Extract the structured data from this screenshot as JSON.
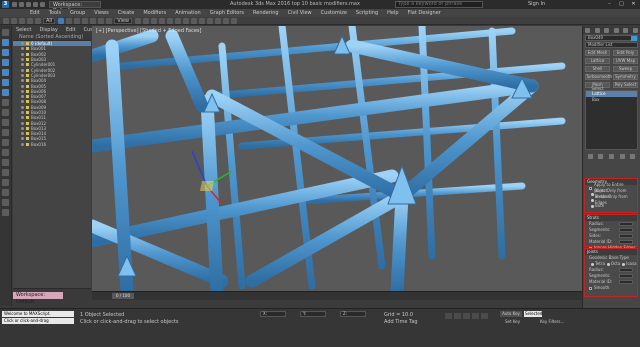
{
  "app": {
    "title": "Autodesk 3ds Max 2016   top 10 basic modifiers.max",
    "workspace": "Workspace: Default",
    "search_placeholder": "Type a keyword or phrase",
    "sign_in": "Sign In"
  },
  "menu": [
    "Edit",
    "Tools",
    "Group",
    "Views",
    "Create",
    "Modifiers",
    "Animation",
    "Graph Editors",
    "Rendering",
    "Civil View",
    "Customize",
    "Scripting",
    "Help",
    "Flat Designer"
  ],
  "toolbar": {
    "selection_filter": "All",
    "view_dropdown": "View"
  },
  "explorer": {
    "tabs": [
      "Select",
      "Display",
      "Edit",
      "Customize"
    ],
    "header": "Name (Sorted Ascending)",
    "items": [
      "0 (default)",
      "Box001",
      "Box002",
      "Box003",
      "Cylinder001",
      "Cylinder002",
      "Cylinder003",
      "Box004",
      "Box005",
      "Box006",
      "Box007",
      "Box008",
      "Box009",
      "Box010",
      "Box011",
      "Box012",
      "Box013",
      "Box014",
      "Box015",
      "Box016"
    ],
    "selected_index": 0
  },
  "viewport": {
    "label": "[+] [Perspective] [Shaded + Edged Faces]"
  },
  "timeline": {
    "frame": "0 / 100"
  },
  "status": {
    "workspace_tag": "Workspace: Default",
    "maxscript_1": "Welcome to MAXScript.",
    "maxscript_2": "Click or click-and-drag",
    "msg1": "1 Object Selected",
    "msg2": "Click or click-and-drag to select objects",
    "x": "X:",
    "y": "Y:",
    "z": "Z:",
    "grid": "Grid = 10.0",
    "add_time_tag": "Add Time Tag",
    "auto_key": "Auto Key",
    "selected": "Selected",
    "set_key": "Set Key",
    "key_filters": "Key Filters..."
  },
  "command_panel": {
    "object_name": "Box040",
    "modifier_list": "Modifier List",
    "buttons": [
      [
        "Edit Mesh",
        "Edit Poly"
      ],
      [
        "Lattice",
        "UVW Map"
      ],
      [
        "Shell",
        "Sweep"
      ],
      [
        "Turbosmooth",
        "Symmetry"
      ],
      [
        "Mesh Select",
        "Poly Select"
      ]
    ],
    "stack": [
      "Lattice",
      "Box"
    ],
    "stack_selected": 0,
    "object_color": "#3c9ad8"
  },
  "rollouts": {
    "geometry": {
      "title": "Geometry",
      "lines": [
        "Apply to Entire Object",
        "Joints Only from Vertices",
        "Struts Only from Edges",
        "Both"
      ]
    },
    "struts": {
      "title": "Struts",
      "lines": [
        "Radius:",
        "Segments:",
        "Sides:",
        "Material ID:",
        "Ignore Hidden Edges",
        "End Caps",
        "Smooth"
      ]
    },
    "joints": {
      "title": "Joints",
      "sub": "Geodesic Base Type",
      "types": [
        "Tetra",
        "Octa",
        "Icosa"
      ],
      "lines": [
        "Radius:",
        "Segments:",
        "Material ID:",
        "Smooth"
      ]
    }
  }
}
